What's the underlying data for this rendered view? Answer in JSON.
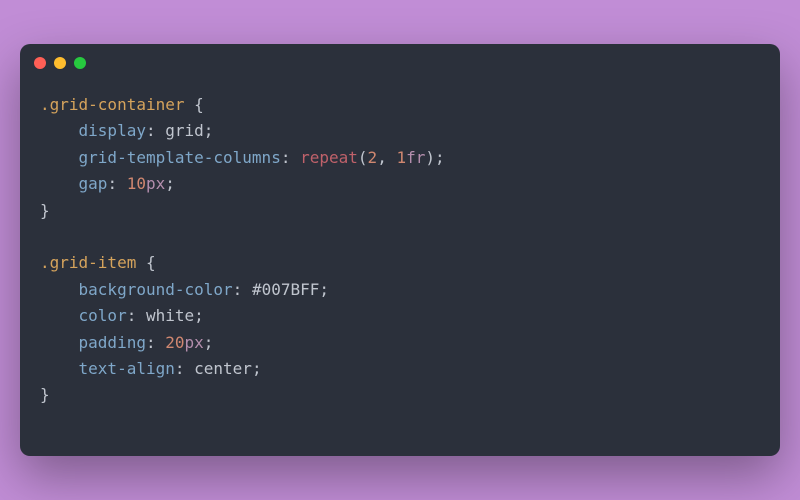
{
  "traffic_lights": {
    "red": "#ff5f56",
    "yellow": "#ffbd2e",
    "green": "#27c93f"
  },
  "code": {
    "rule1": {
      "selector": ".grid-container",
      "decl1_prop": "display",
      "decl1_val": "grid",
      "decl2_prop": "grid-template-columns",
      "decl2_fn": "repeat",
      "decl2_arg1": "2",
      "decl2_arg2_num": "1",
      "decl2_arg2_unit": "fr",
      "decl3_prop": "gap",
      "decl3_num": "10",
      "decl3_unit": "px"
    },
    "rule2": {
      "selector": ".grid-item",
      "decl1_prop": "background-color",
      "decl1_val": "#007BFF",
      "decl2_prop": "color",
      "decl2_val": "white",
      "decl3_prop": "padding",
      "decl3_num": "20",
      "decl3_unit": "px",
      "decl4_prop": "text-align",
      "decl4_val": "center"
    }
  },
  "punct": {
    "open_brace": "{",
    "close_brace": "}",
    "colon": ":",
    "semicolon": ";",
    "open_paren": "(",
    "close_paren": ")",
    "comma": ","
  }
}
